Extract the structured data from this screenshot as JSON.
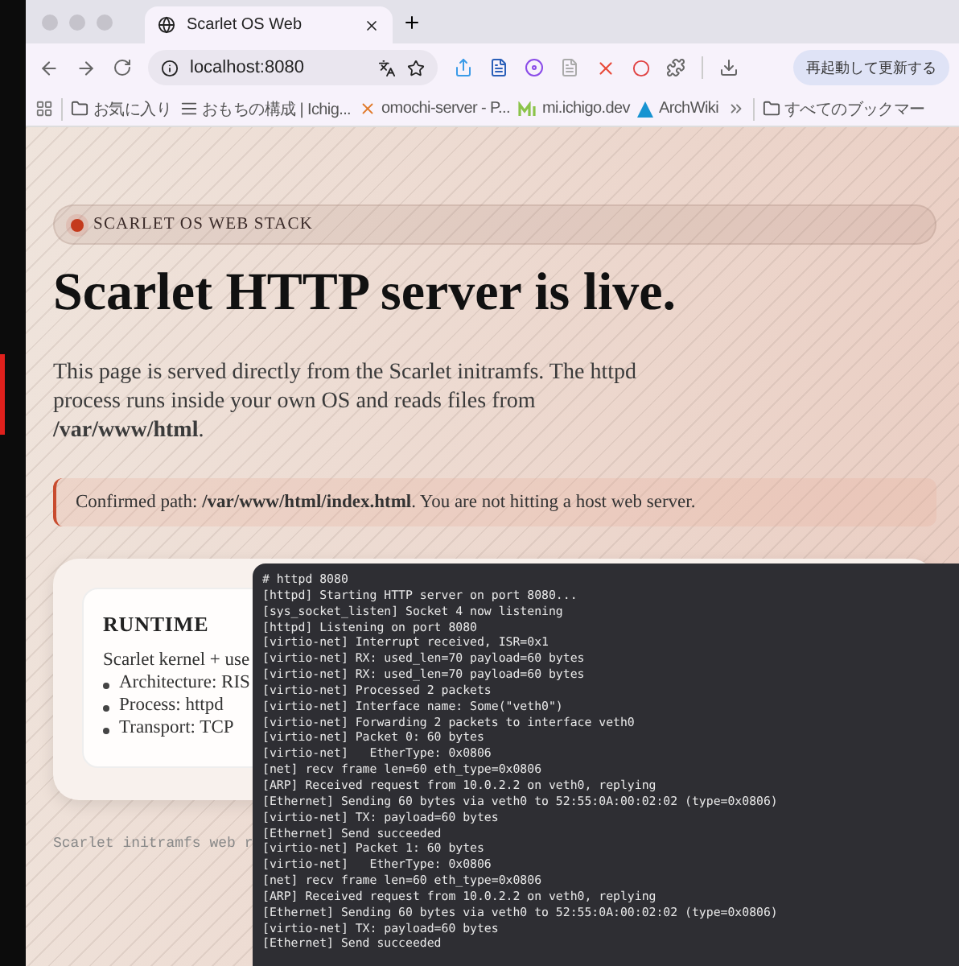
{
  "browser": {
    "tabs": [
      {
        "title": "Scarlet OS Web",
        "selected": true
      }
    ],
    "address": "localhost:8080",
    "update_button": "再起動して更新する",
    "bookmarks": [
      {
        "kind": "folder",
        "label": "お気に入り"
      },
      {
        "kind": "list",
        "label": "おもちの構成 | Ichig..."
      },
      {
        "kind": "cross",
        "label": "omochi-server - P..."
      },
      {
        "kind": "mi",
        "label": "mi.ichigo.dev"
      },
      {
        "kind": "arch",
        "label": "ArchWiki"
      }
    ],
    "all_bookmarks": "すべてのブックマー"
  },
  "page": {
    "badge": "SCARLET OS WEB STACK",
    "title": "Scarlet HTTP server is live.",
    "intro": "This page is served directly from the Scarlet initramfs. The httpd process runs inside your own OS and reads files from **/var/www/html**.",
    "notice": "Confirmed path: **/var/www/html/index.html**. You are not hitting a host web server.",
    "runtime": {
      "heading": "RUNTIME",
      "summary": "Scarlet kernel + use",
      "items": [
        "Architecture: RIS",
        "Process: httpd",
        "Transport: TCP"
      ]
    },
    "footer": "Scarlet initramfs web r"
  },
  "terminal": {
    "lines": [
      "# httpd 8080",
      "[httpd] Starting HTTP server on port 8080...",
      "[sys_socket_listen] Socket 4 now listening",
      "[httpd] Listening on port 8080",
      "[virtio-net] Interrupt received, ISR=0x1",
      "[virtio-net] RX: used_len=70 payload=60 bytes",
      "[virtio-net] RX: used_len=70 payload=60 bytes",
      "[virtio-net] Processed 2 packets",
      "[virtio-net] Interface name: Some(\"veth0\")",
      "[virtio-net] Forwarding 2 packets to interface veth0",
      "[virtio-net] Packet 0: 60 bytes",
      "[virtio-net]   EtherType: 0x0806",
      "[net] recv frame len=60 eth_type=0x0806",
      "[ARP] Received request from 10.0.2.2 on veth0, replying",
      "[Ethernet] Sending 60 bytes via veth0 to 52:55:0A:00:02:02 (type=0x0806)",
      "[virtio-net] TX: payload=60 bytes",
      "[Ethernet] Send succeeded",
      "[virtio-net] Packet 1: 60 bytes",
      "[virtio-net]   EtherType: 0x0806",
      "[net] recv frame len=60 eth_type=0x0806",
      "[ARP] Received request from 10.0.2.2 on veth0, replying",
      "[Ethernet] Sending 60 bytes via veth0 to 52:55:0A:00:02:02 (type=0x0806)",
      "[virtio-net] TX: payload=60 bytes",
      "[Ethernet] Send succeeded"
    ]
  }
}
